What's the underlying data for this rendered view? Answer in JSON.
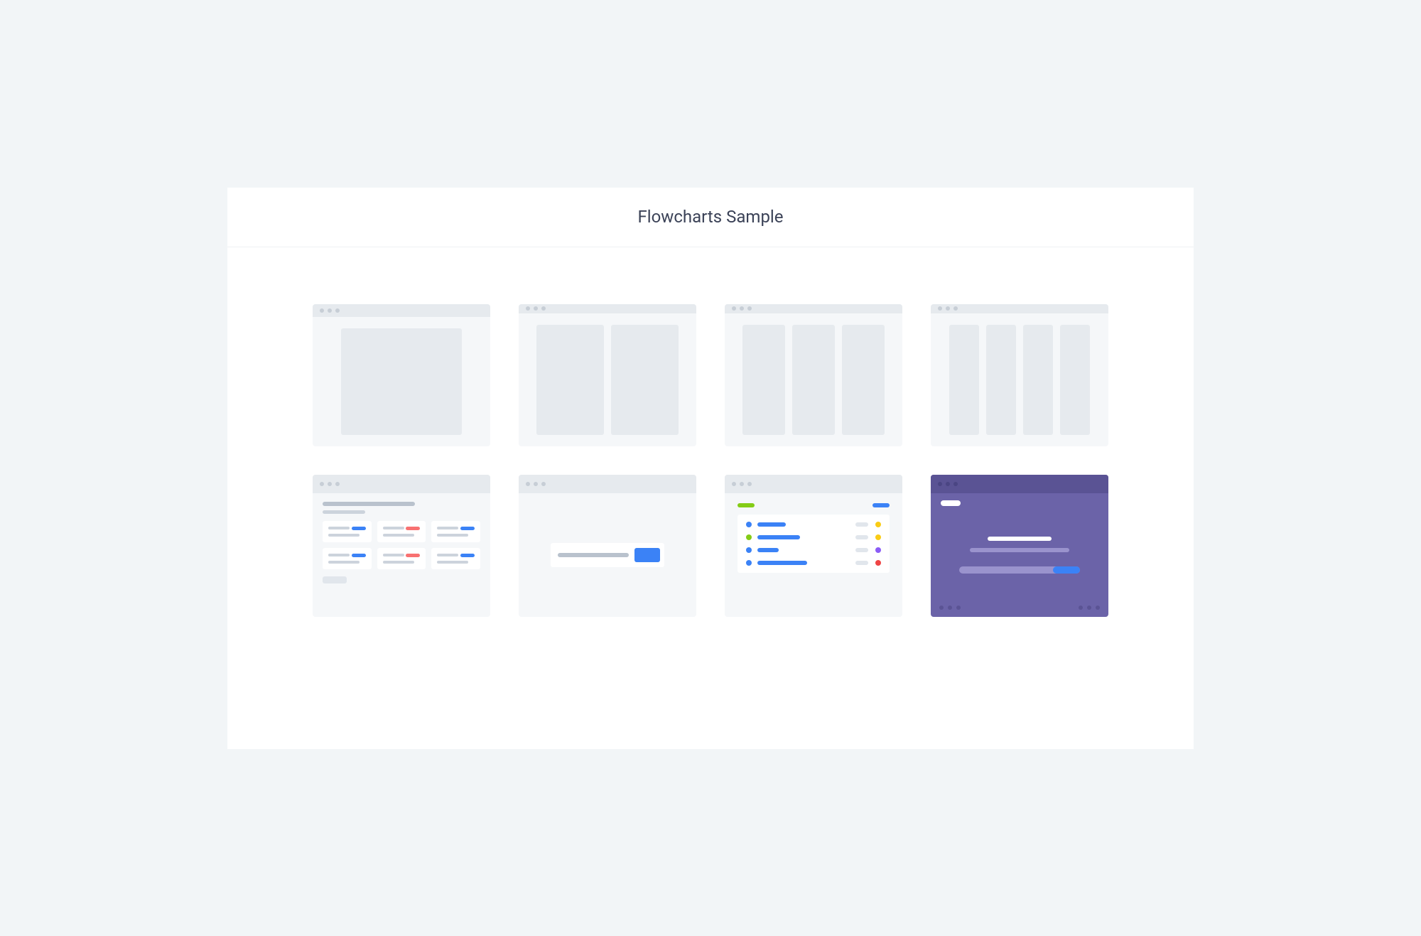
{
  "header": {
    "title": "Flowcharts Sample"
  },
  "tiles": [
    {
      "name": "layout-single"
    },
    {
      "name": "layout-two-column"
    },
    {
      "name": "layout-three-column"
    },
    {
      "name": "layout-four-column"
    },
    {
      "name": "kanban-board"
    },
    {
      "name": "search-dialog"
    },
    {
      "name": "task-list"
    },
    {
      "name": "dark-onboarding"
    }
  ],
  "colors": {
    "page_bg": "#f2f5f7",
    "panel_bg": "#ffffff",
    "placeholder": "#e6eaee",
    "blue": "#3b82f6",
    "red": "#f87171",
    "green": "#84cc16",
    "yellow": "#facc15",
    "purple": "#8b5cf6",
    "dark_purple": "#6b63a8"
  }
}
